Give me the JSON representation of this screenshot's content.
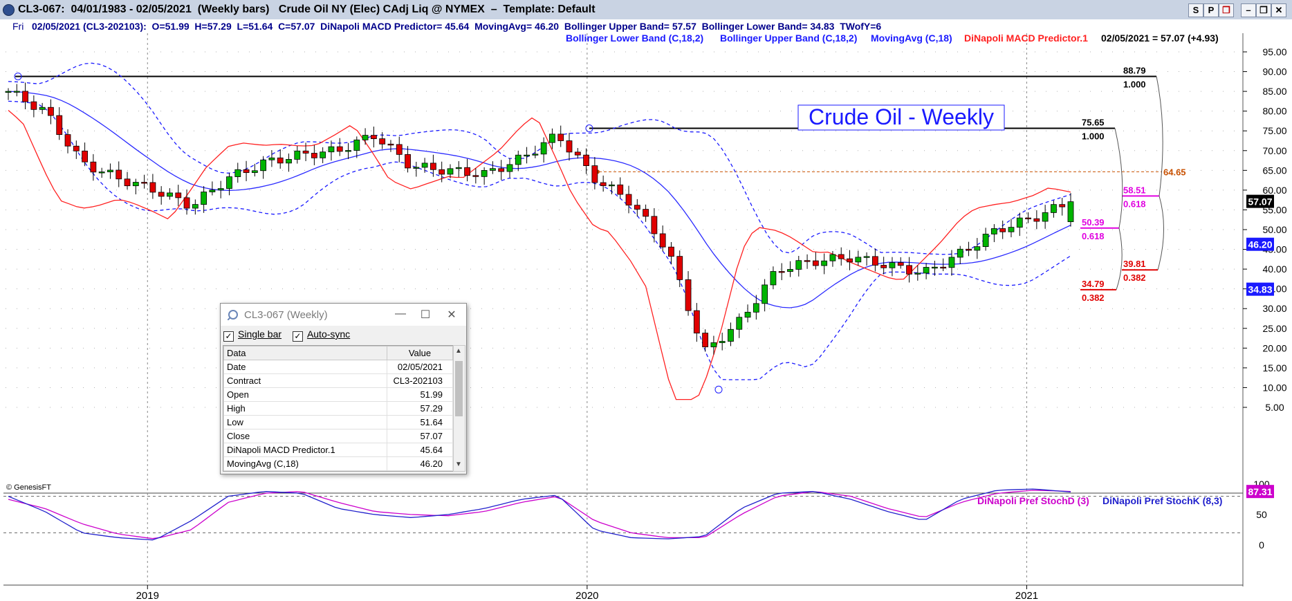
{
  "window": {
    "title": "CL3-067:  04/01/1983 - 02/05/2021  (Weekly bars)   Crude Oil NY (Elec) CAdj Liq @ NYMEX  –  Template: Default",
    "buttons": [
      "S",
      "P",
      "❐",
      "–",
      "❐",
      "✕"
    ]
  },
  "infobar": {
    "day": "Fri",
    "text": "02/05/2021 (CL3-202103):  O=51.99  H=57.29  L=51.64  C=57.07  DiNapoli MACD Predictor= 45.64  MovingAvg= 46.20  Bollinger Upper Band= 57.57  Bollinger Lower Band= 34.83  TWofY=6"
  },
  "legend": {
    "lower": "Bollinger Lower Band (C,18,2)",
    "upper": "Bollinger Upper Band (C,18,2)",
    "ma": "MovingAvg (C,18)",
    "macd": "DiNapoli MACD Predictor.1",
    "last": "02/05/2021 = 57.07 (+4.93)",
    "stochd": "DiNapoli Pref StochD (3)",
    "stochk": "DiNapoli Pref StochK (8,3)"
  },
  "annotation": "Crude Oil - Weekly",
  "copyright": "© GenesisFT",
  "colors": {
    "bull": "#00b400",
    "bear": "#e00000",
    "bollinger": "#1a1aff",
    "ma": "#2a2aff",
    "macd": "#ff2020",
    "stochd": "#cc00cc",
    "stochk": "#2020cc",
    "fibo_magenta": "#e000e0",
    "fibo_red": "#e00000",
    "orange_level": "#c85000"
  },
  "chart_data": [
    {
      "type": "candlestick",
      "x": [
        "2018-09",
        "2018-10",
        "2018-11",
        "2018-12",
        "2019-01",
        "2019-02",
        "2019-03",
        "2019-04",
        "2019-05",
        "2019-06",
        "2019-07",
        "2019-08",
        "2019-09",
        "2019-10",
        "2019-11",
        "2019-12",
        "2020-01",
        "2020-02",
        "2020-03",
        "2020-04",
        "2020-05",
        "2020-06",
        "2020-07",
        "2020-08",
        "2020-09",
        "2020-10",
        "2020-11",
        "2020-12",
        "2021-01",
        "2021-02"
      ],
      "close": [
        85,
        80,
        67,
        63,
        60,
        56,
        63,
        67,
        69,
        70,
        74,
        66,
        65,
        64,
        68,
        74,
        63,
        57,
        45,
        19,
        27,
        40,
        42,
        43,
        41,
        39,
        44,
        50,
        53,
        57.07
      ],
      "xlabels": [
        "2019",
        "2020",
        "2021"
      ],
      "ylim": [
        0,
        95
      ],
      "yticks": [
        "95.00",
        "90.00",
        "85.00",
        "80.00",
        "75.00",
        "70.00",
        "65.00",
        "60.00",
        "55.00",
        "50.00",
        "45.00",
        "40.00",
        "35.00",
        "30.00",
        "25.00",
        "20.00",
        "15.00",
        "10.00",
        "5.00"
      ],
      "value_tags": [
        "57.07",
        "46.20",
        "34.83"
      ],
      "levels": [
        {
          "value": 88.79,
          "label": "88.79",
          "ratio": "1.000"
        },
        {
          "value": 75.65,
          "label": "75.65",
          "ratio": "1.000"
        },
        {
          "value": 64.65,
          "label": "64.65"
        },
        {
          "value": 58.51,
          "label": "58.51",
          "ratio": "0.618"
        },
        {
          "value": 50.39,
          "label": "50.39",
          "ratio": "0.618"
        },
        {
          "value": 39.81,
          "label": "39.81",
          "ratio": "0.382"
        },
        {
          "value": 34.79,
          "label": "34.79",
          "ratio": "0.382"
        }
      ]
    },
    {
      "type": "line",
      "series": [
        {
          "name": "DiNapoli Pref StochD (3)",
          "values": [
            75,
            60,
            35,
            18,
            10,
            25,
            70,
            85,
            88,
            70,
            55,
            50,
            48,
            55,
            70,
            80,
            40,
            20,
            12,
            12,
            50,
            80,
            88,
            80,
            60,
            45,
            70,
            85,
            90,
            88
          ]
        },
        {
          "name": "DiNapoli Pref StochK (8,3)",
          "values": [
            80,
            55,
            20,
            12,
            8,
            40,
            80,
            88,
            85,
            60,
            50,
            45,
            50,
            60,
            75,
            82,
            25,
            12,
            10,
            14,
            60,
            85,
            88,
            75,
            55,
            40,
            75,
            90,
            92,
            87
          ]
        }
      ],
      "ylim": [
        0,
        100
      ],
      "yticks": [
        "100",
        "50",
        "0"
      ],
      "value_tag": "87.31"
    }
  ],
  "dialog": {
    "title": "CL3-067 (Weekly)",
    "single_bar": "Single bar",
    "auto_sync": "Auto-sync",
    "col_data": "Data",
    "col_value": "Value",
    "rows": [
      {
        "k": "Date",
        "v": "02/05/2021"
      },
      {
        "k": "Contract",
        "v": "CL3-202103"
      },
      {
        "k": "Open",
        "v": "51.99"
      },
      {
        "k": "High",
        "v": "57.29"
      },
      {
        "k": "Low",
        "v": "51.64"
      },
      {
        "k": "Close",
        "v": "57.07"
      },
      {
        "k": "DiNapoli MACD Predictor.1",
        "v": "45.64"
      },
      {
        "k": "MovingAvg (C,18)",
        "v": "46.20"
      }
    ]
  }
}
